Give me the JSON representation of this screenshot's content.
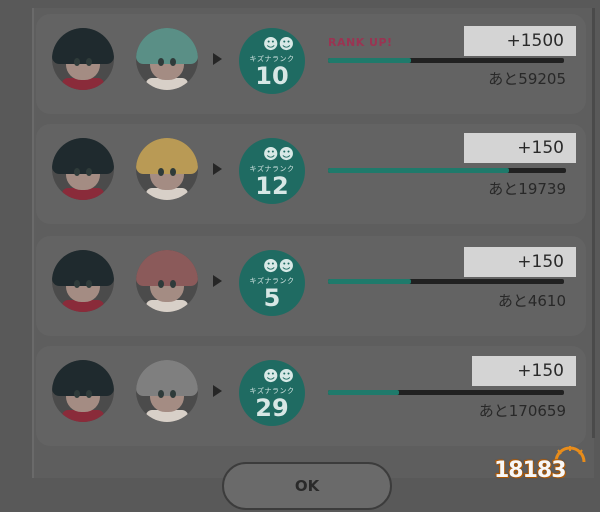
{
  "rows": [
    {
      "left_avatar": "left-character-avatar",
      "right_avatar": "green-hair-character-avatar",
      "badge_label": "キズナランク",
      "rank": "10",
      "rank_up_text": "RANK UP!",
      "gain": "+1500",
      "remaining": "あと59205",
      "progress": 0.35,
      "hair_color": "#5a8f86",
      "collar_color": "#8a2b3a"
    },
    {
      "left_avatar": "left-character-avatar",
      "right_avatar": "blonde-hair-character-avatar",
      "badge_label": "キズナランク",
      "rank": "12",
      "rank_up_text": "",
      "gain": "+150",
      "remaining": "あと19739",
      "progress": 0.76,
      "hair_color": "#b99a55",
      "collar_color": "#8a2b3a"
    },
    {
      "left_avatar": "left-character-avatar",
      "right_avatar": "pink-hair-character-avatar",
      "badge_label": "キズナランク",
      "rank": "5",
      "rank_up_text": "",
      "gain": "+150",
      "remaining": "あと4610",
      "progress": 0.35,
      "hair_color": "#8b5a5a",
      "collar_color": "#8a2b3a"
    },
    {
      "left_avatar": "left-character-avatar",
      "right_avatar": "silver-hair-character-avatar",
      "badge_label": "キズナランク",
      "rank": "29",
      "rank_up_text": "",
      "gain": "+150",
      "remaining": "あと170659",
      "progress": 0.3,
      "hair_color": "#7f7f7f",
      "collar_color": "#8a2b3a"
    }
  ],
  "left_hair_color": "#1f2a2e",
  "ok_label": "OK",
  "watermark_text": "18183",
  "colors": {
    "accent": "#1f6b62",
    "rank_up": "#9a3452"
  }
}
